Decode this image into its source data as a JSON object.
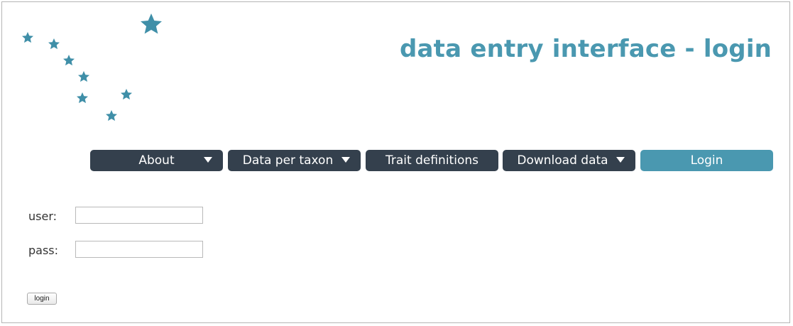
{
  "header": {
    "title": "data entry interface - login"
  },
  "logo": {
    "icon": "star-constellation-logo",
    "color": "#3f8fa8"
  },
  "nav": {
    "items": [
      {
        "label": "About",
        "has_dropdown": true,
        "active": false
      },
      {
        "label": "Data per taxon",
        "has_dropdown": true,
        "active": false
      },
      {
        "label": "Trait definitions",
        "has_dropdown": false,
        "active": false
      },
      {
        "label": "Download data",
        "has_dropdown": true,
        "active": false
      },
      {
        "label": "Login",
        "has_dropdown": false,
        "active": true
      }
    ],
    "colors": {
      "default": "#34404d",
      "active": "#4a98b0",
      "text": "#ffffff"
    }
  },
  "login_form": {
    "user_label": "user:",
    "user_value": "",
    "pass_label": "pass:",
    "pass_value": "",
    "submit_label": "login"
  }
}
